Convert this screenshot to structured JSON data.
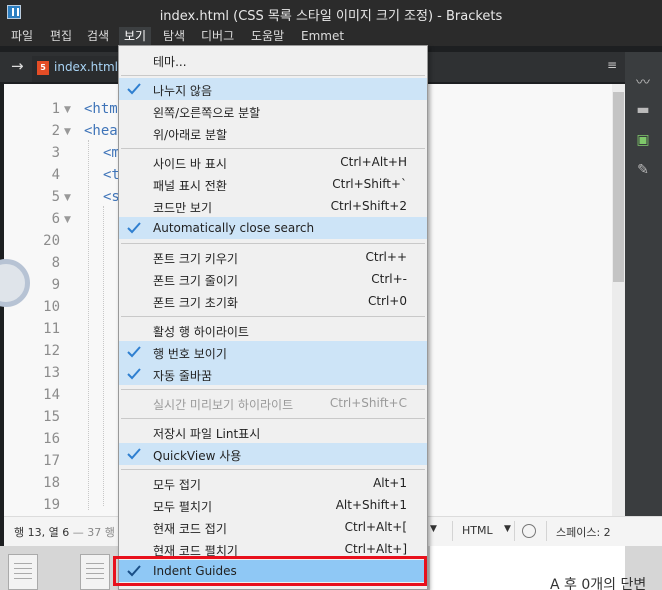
{
  "window": {
    "title": "index.html (CSS 목록 스타일 이미지 크기 조정) - Brackets"
  },
  "menubar": [
    "파일",
    "편집",
    "검색",
    "보기",
    "탐색",
    "디버그",
    "도움말",
    "Emmet"
  ],
  "tab": {
    "filename": "index.html",
    "file_icon": "html5-icon"
  },
  "editor": {
    "lines": [
      {
        "n": "1",
        "code": "<htm",
        "fold": "▼"
      },
      {
        "n": "2",
        "code": "<hea",
        "fold": "▼"
      },
      {
        "n": "3",
        "code": "<m"
      },
      {
        "n": "4",
        "code": "<t"
      },
      {
        "n": "5",
        "code": "<s",
        "fold": "▼"
      },
      {
        "n": "6",
        "code": "",
        "fold": "▼"
      },
      {
        "n": "20",
        "code": ""
      },
      {
        "n": "8",
        "code": ""
      },
      {
        "n": "9",
        "code": ""
      },
      {
        "n": "10",
        "code": ""
      },
      {
        "n": "11",
        "code": ""
      },
      {
        "n": "12",
        "code": ""
      },
      {
        "n": "13",
        "code": ""
      },
      {
        "n": "14",
        "code": ""
      },
      {
        "n": "15",
        "code": ""
      },
      {
        "n": "16",
        "code": ""
      },
      {
        "n": "17",
        "code": ""
      },
      {
        "n": "18",
        "code": ""
      },
      {
        "n": "19",
        "code": ""
      }
    ]
  },
  "status": {
    "position": "행 13, 열 6",
    "lines": "— 37 행",
    "language": "HTML",
    "indent": "스페이스: 2"
  },
  "view_menu": {
    "items": [
      {
        "label": "테마...",
        "shortcut": "",
        "checked": false,
        "disabled": false
      },
      {
        "label": "나누지 않음",
        "shortcut": "",
        "checked": true,
        "disabled": false
      },
      {
        "label": "왼쪽/오른쪽으로 분할",
        "shortcut": "",
        "checked": false,
        "disabled": false
      },
      {
        "label": "위/아래로 분할",
        "shortcut": "",
        "checked": false,
        "disabled": false
      },
      {
        "label": "사이드 바 표시",
        "shortcut": "Ctrl+Alt+H",
        "checked": false,
        "disabled": false
      },
      {
        "label": "패널 표시 전환",
        "shortcut": "Ctrl+Shift+`",
        "checked": false,
        "disabled": false
      },
      {
        "label": "코드만 보기",
        "shortcut": "Ctrl+Shift+2",
        "checked": false,
        "disabled": false
      },
      {
        "label": "Automatically close search",
        "shortcut": "",
        "checked": true,
        "disabled": false
      },
      {
        "label": "폰트 크기 키우기",
        "shortcut": "Ctrl++",
        "checked": false,
        "disabled": false
      },
      {
        "label": "폰트 크기 줄이기",
        "shortcut": "Ctrl+-",
        "checked": false,
        "disabled": false
      },
      {
        "label": "폰트 크기 초기화",
        "shortcut": "Ctrl+0",
        "checked": false,
        "disabled": false
      },
      {
        "label": "활성 행 하이라이트",
        "shortcut": "",
        "checked": false,
        "disabled": false
      },
      {
        "label": "행 번호 보이기",
        "shortcut": "",
        "checked": true,
        "disabled": false
      },
      {
        "label": "자동 줄바꿈",
        "shortcut": "",
        "checked": true,
        "disabled": false
      },
      {
        "label": "실시간 미리보기 하이라이트",
        "shortcut": "Ctrl+Shift+C",
        "checked": false,
        "disabled": true
      },
      {
        "label": "저장시 파일 Lint표시",
        "shortcut": "",
        "checked": false,
        "disabled": false
      },
      {
        "label": "QuickView 사용",
        "shortcut": "",
        "checked": true,
        "disabled": false
      },
      {
        "label": "모두 접기",
        "shortcut": "Alt+1",
        "checked": false,
        "disabled": false
      },
      {
        "label": "모두 펼치기",
        "shortcut": "Alt+Shift+1",
        "checked": false,
        "disabled": false
      },
      {
        "label": "현재 코드 접기",
        "shortcut": "Ctrl+Alt+[",
        "checked": false,
        "disabled": false
      },
      {
        "label": "현재 코드 펼치기",
        "shortcut": "Ctrl+Alt+]",
        "checked": false,
        "disabled": false
      },
      {
        "label": "Indent Guides",
        "shortcut": "",
        "checked": true,
        "disabled": false
      }
    ]
  },
  "background_snippet": "A 후 0개의 단변",
  "colors": {
    "highlight": "#8fc8f5",
    "annotation_box": "#e8101c",
    "check": "#2f7fd0"
  }
}
